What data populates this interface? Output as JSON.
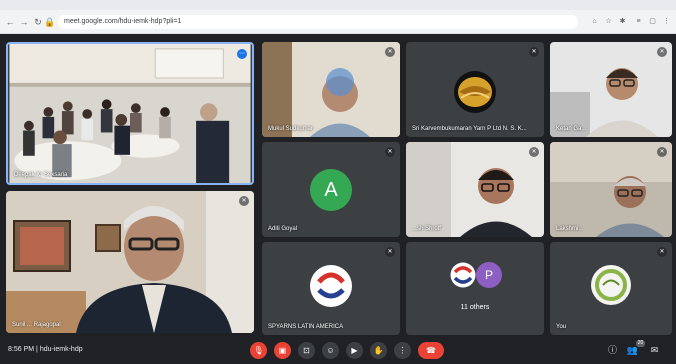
{
  "browser": {
    "url": "meet.google.com/hdu-iemk-hdp?pli=1",
    "tabs": [
      "",
      "",
      "",
      "",
      "",
      ""
    ]
  },
  "tiles": [
    {
      "name": "Deepak Kr Seksaria",
      "mic_muted": false,
      "kind": "video-room"
    },
    {
      "name": "Mukul Sudkumar",
      "mic_muted": true,
      "kind": "video-person"
    },
    {
      "name": "Sri Karvembukumaran Yarn P Ltd N. S. K...",
      "mic_muted": true,
      "kind": "logo-yarn"
    },
    {
      "name": "Ketan Ga...",
      "mic_muted": true,
      "kind": "video-person"
    },
    {
      "name": "Aditi Goyal",
      "mic_muted": true,
      "kind": "avatar",
      "avatar_letter": "A",
      "avatar_color": "#34a853"
    },
    {
      "name": "...sh Shroff",
      "mic_muted": true,
      "kind": "video-person"
    },
    {
      "name": "Lakshmi...",
      "mic_muted": true,
      "kind": "video-person"
    },
    {
      "name": "Sunil ... Rajagopal",
      "mic_muted": true,
      "kind": "video-speaker"
    },
    {
      "name": "SPYARNS LATIN AMERICA",
      "mic_muted": true,
      "kind": "logo-spyarns"
    },
    {
      "name": "11 others",
      "mic_muted": false,
      "kind": "others",
      "avatar_letter": "P",
      "avatar_color": "#8e5fc2"
    },
    {
      "name": "You",
      "mic_muted": true,
      "kind": "logo-you"
    }
  ],
  "bottom": {
    "time": "8:56 PM",
    "separator": "|",
    "meeting_code": "hdu-iemk-hdp",
    "participants_count": "20"
  },
  "colors": {
    "accent_red": "#ea4335",
    "background": "#202124",
    "tile": "#3c4043"
  }
}
